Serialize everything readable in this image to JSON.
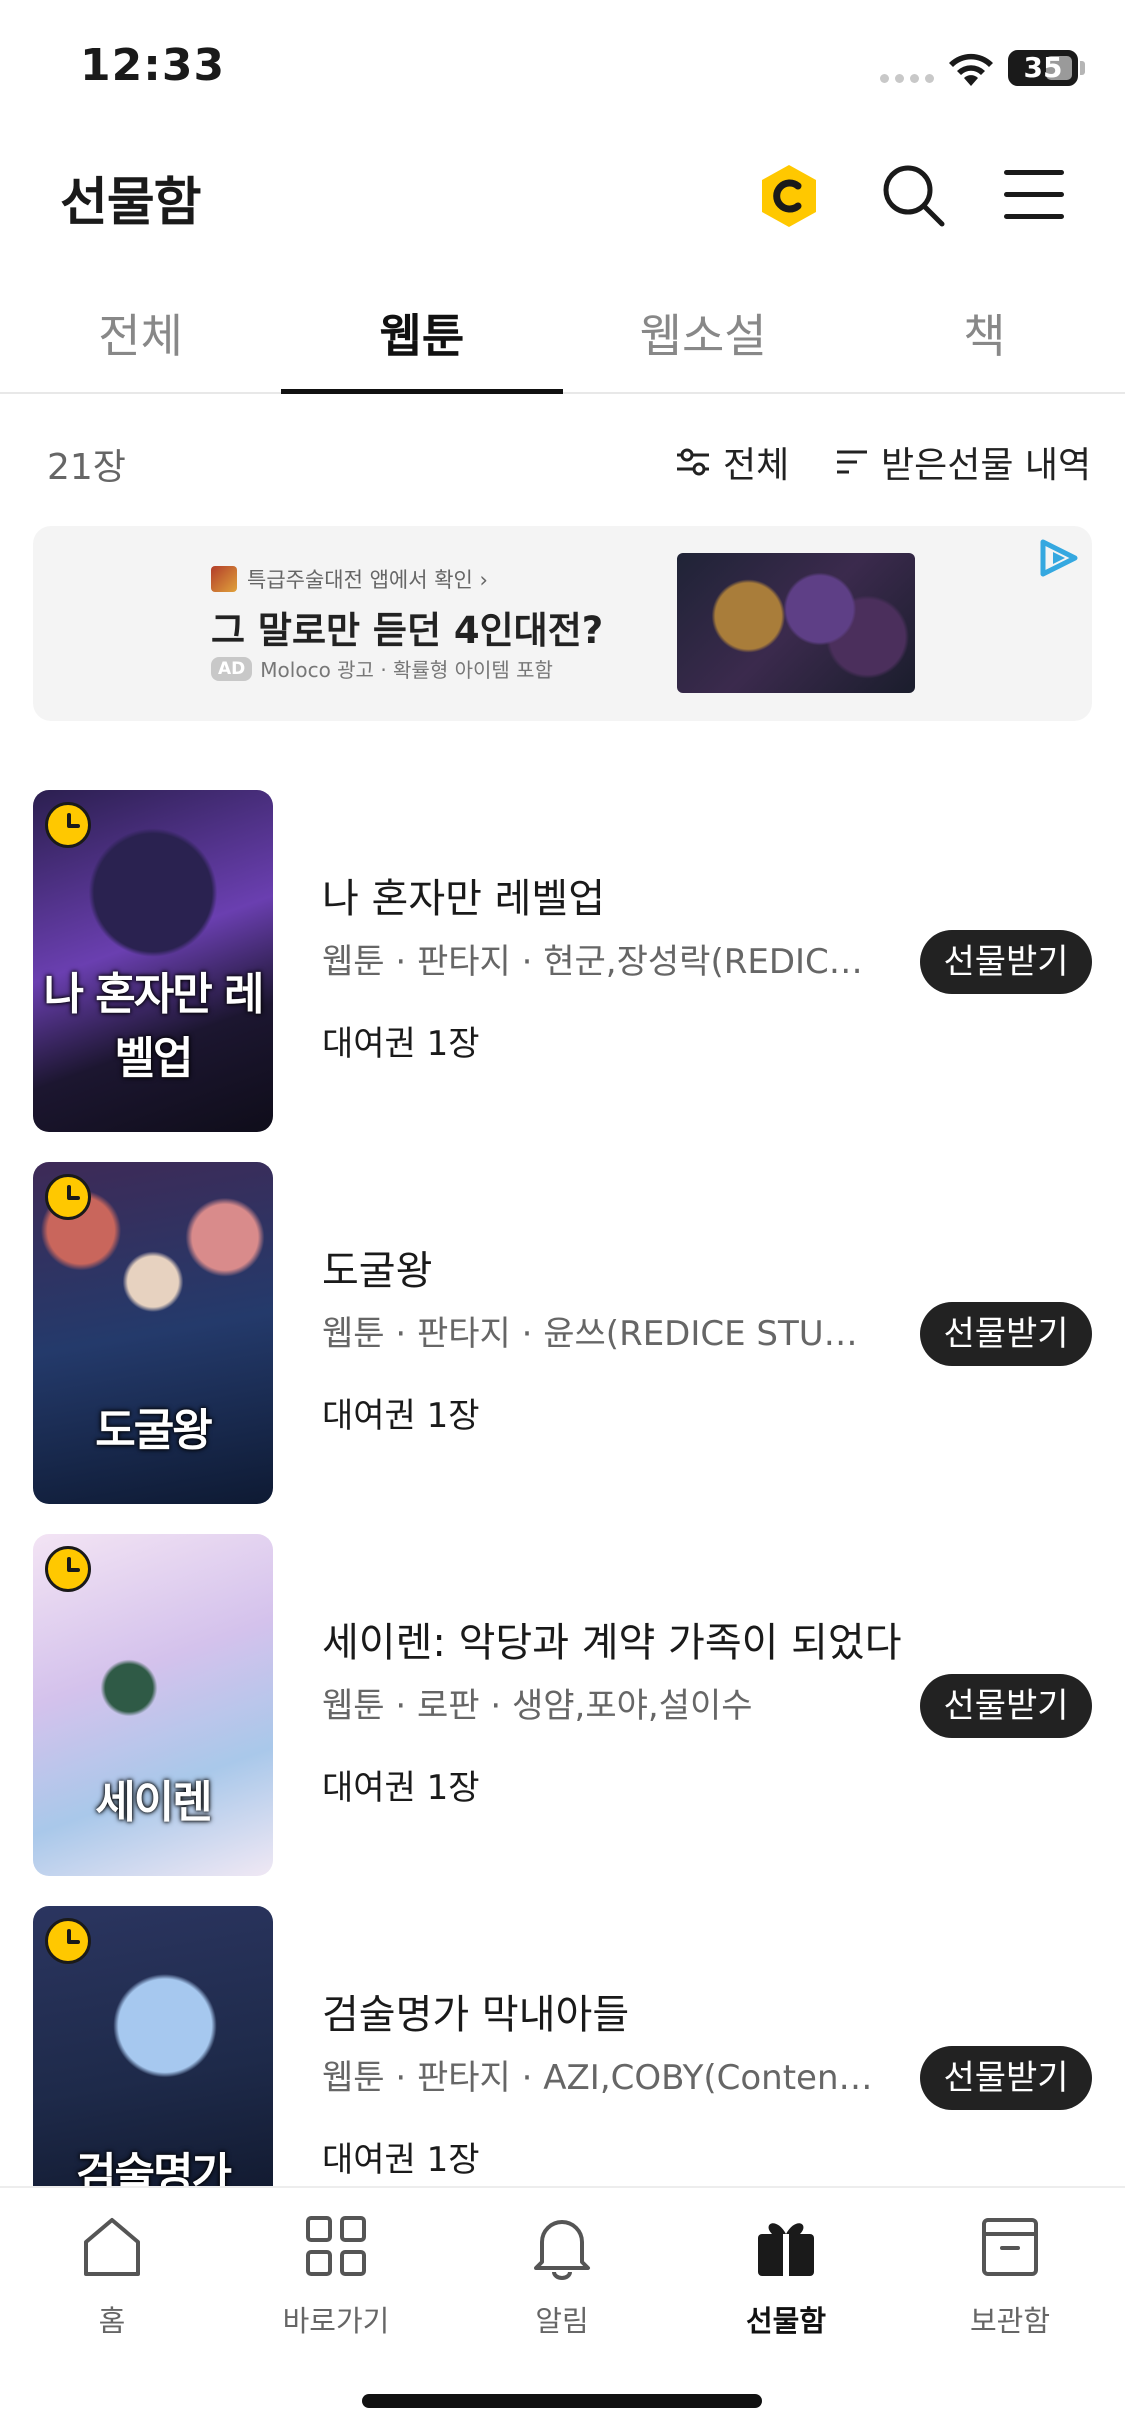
{
  "status_bar": {
    "time": "12:33",
    "battery": "35"
  },
  "header": {
    "title": "선물함"
  },
  "tabs": [
    {
      "label": "전체",
      "active": false
    },
    {
      "label": "웹툰",
      "active": true
    },
    {
      "label": "웹소설",
      "active": false
    },
    {
      "label": "책",
      "active": false
    }
  ],
  "filter": {
    "count": "21장",
    "filter_label": "전체",
    "history_label": "받은선물 내역"
  },
  "ad": {
    "source": "특급주술대전 앱에서 확인 ›",
    "headline": "그 말로만 듣던 4인대전?",
    "badge": "AD",
    "meta": "Moloco 광고 · 확률형 아이템 포함"
  },
  "items": [
    {
      "cover_text": "나 혼자만 레벨업",
      "title": "나 혼자만 레벨업",
      "meta": "웹툰 · 판타지 · 현군,장성락(REDICE STUDIO)",
      "ticket": "대여권 1장",
      "button": "선물받기"
    },
    {
      "cover_text": "도굴왕",
      "title": "도굴왕",
      "meta": "웹툰 · 판타지 · 윤쓰(REDICE STUDIO)",
      "ticket": "대여권 1장",
      "button": "선물받기"
    },
    {
      "cover_text": "세이렌",
      "title": "세이렌: 악당과 계약 가족이 되었다",
      "meta": "웹툰 · 로판 · 생얌,포야,설이수",
      "ticket": "대여권 1장",
      "button": "선물받기"
    },
    {
      "cover_text": "검술명가",
      "title": "검술명가 막내아들",
      "meta": "웹툰 · 판타지 · AZI,COBY(Contents)",
      "ticket": "대여권 1장",
      "button": "선물받기"
    }
  ],
  "bottom_nav": [
    {
      "label": "홈",
      "icon": "home-icon",
      "active": false
    },
    {
      "label": "바로가기",
      "icon": "grid-icon",
      "active": false
    },
    {
      "label": "알림",
      "icon": "bell-icon",
      "active": false
    },
    {
      "label": "선물함",
      "icon": "gift-icon",
      "active": true
    },
    {
      "label": "보관함",
      "icon": "archive-icon",
      "active": false
    }
  ],
  "colors": {
    "accent_yellow": "#ffc800",
    "button_dark": "#222222",
    "text_primary": "#1a1a1a",
    "text_secondary": "#666666"
  }
}
